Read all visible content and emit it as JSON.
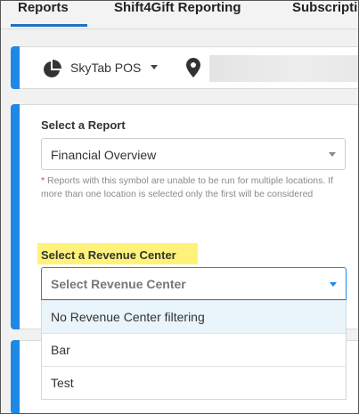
{
  "tabs": [
    {
      "label": "Reports"
    },
    {
      "label": "Shift4Gift Reporting"
    },
    {
      "label": "Subscripti"
    }
  ],
  "location_bar": {
    "pos_name": "SkyTab POS",
    "icons": [
      "pie-chart-icon",
      "map-pin-icon"
    ]
  },
  "report": {
    "select_label": "Select a Report",
    "selected_report": "Financial Overview",
    "note_star": "*",
    "note_text": " Reports with this symbol are unable to be run for multiple locations. If more than one location is selected only the first will be considered"
  },
  "revenue_center": {
    "label": "Select a Revenue Center",
    "placeholder": "Select Revenue Center",
    "options": [
      "No Revenue Center filtering",
      "Bar",
      "Test"
    ]
  },
  "colors": {
    "accent": "#1e88e5",
    "highlight": "#fff27a",
    "required_star": "#e04040"
  }
}
